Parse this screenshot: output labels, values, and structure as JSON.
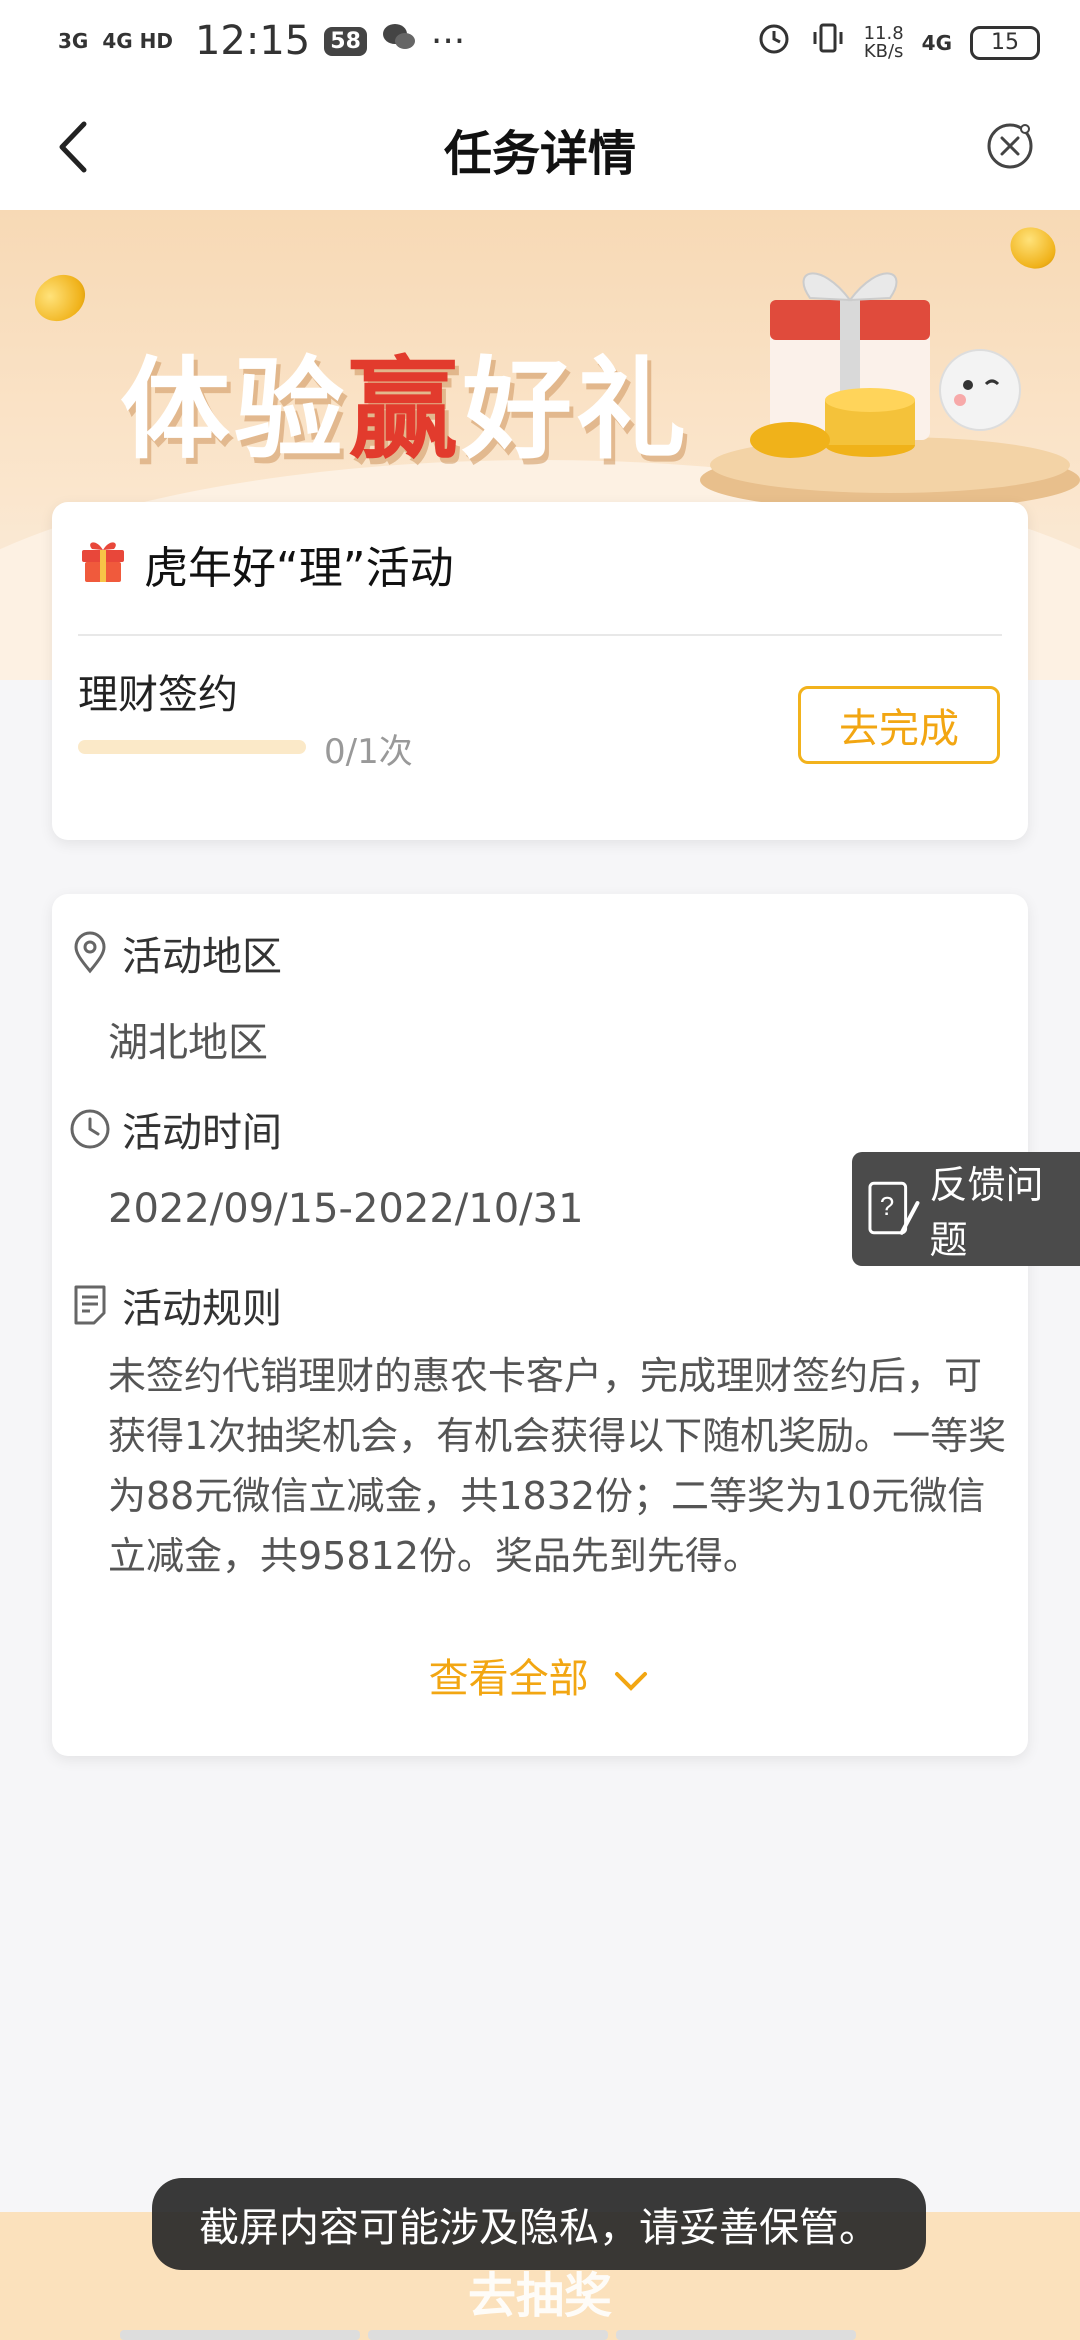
{
  "status_bar": {
    "network_left": "3G",
    "network_right": "4G HD",
    "time": "12:15",
    "badge": "58",
    "more": "···",
    "speed_value": "11.8",
    "speed_unit": "KB/s",
    "network_type": "4G",
    "battery": "15"
  },
  "header": {
    "title": "任务详情"
  },
  "banner": {
    "title_pre": "体验",
    "title_win": "赢",
    "title_post": "好礼"
  },
  "task_card": {
    "activity_name": "虎年好“理”活动",
    "task_name": "理财签约",
    "progress_text": "0/1次",
    "progress_value": 0,
    "action_label": "去完成"
  },
  "info_card": {
    "region_label": "活动地区",
    "region_value": "湖北地区",
    "time_label": "活动时间",
    "time_value": "2022/09/15-2022/10/31",
    "rules_label": "活动规则",
    "rules_text": "未签约代销理财的惠农卡客户，完成理财签约后，可获得1次抽奖机会，有机会获得以下随机奖励。一等奖为88元微信立减金，共1832份；二等奖为10元微信立减金，共95812份。奖品先到先得。",
    "view_all": "查看全部"
  },
  "feedback": {
    "label": "反馈问题"
  },
  "bottom": {
    "label": "去抽奖"
  },
  "toast": {
    "text": "截屏内容可能涉及隐私，请妥善保管。"
  },
  "colors": {
    "accent": "#f2a612",
    "banner_red": "#e23b2d",
    "toast_bg": "#282828"
  }
}
